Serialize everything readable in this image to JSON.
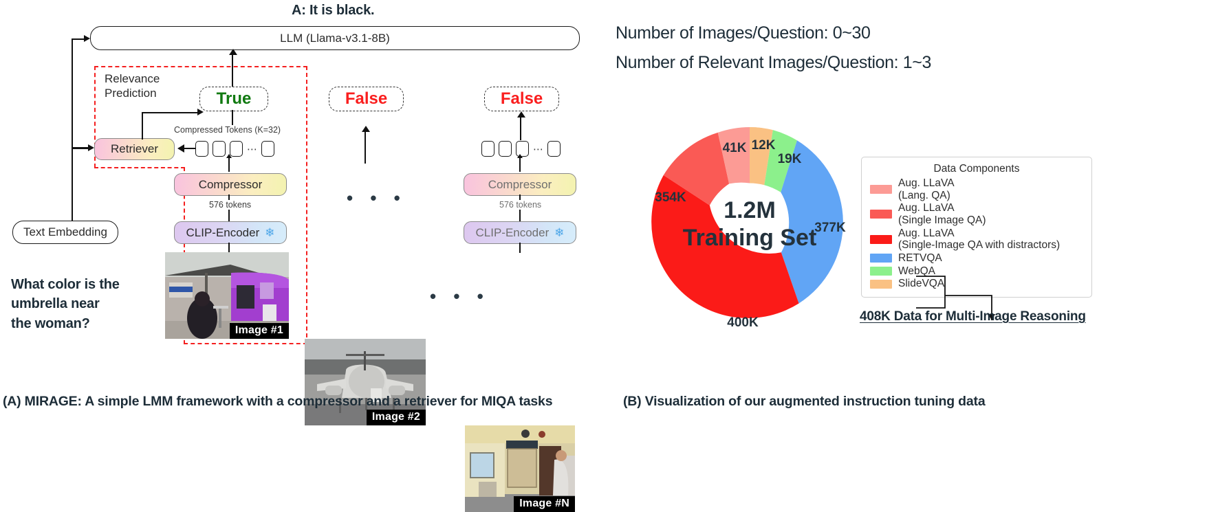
{
  "figure": {
    "panel_a_caption": "(A) MIRAGE: A simple LMM framework with a compressor and a retriever for MIQA tasks",
    "panel_b_caption": "(B) Visualization of our augmented instruction tuning data"
  },
  "panel_a": {
    "answer": "A: It is black.",
    "llm_box": "LLM (Llama-v3.1-8B)",
    "relevance_prediction": "Relevance\nPrediction",
    "relevance_prediction_line1": "Relevance",
    "relevance_prediction_line2": "Prediction",
    "retriever": "Retriever",
    "text_embedding": "Text Embedding",
    "question": "What color is the\numbrella near\nthe woman?",
    "question_line1": "What color is the",
    "question_line2": "umbrella near",
    "question_line3": "the woman?",
    "compressed_tokens_label": "Compressed Tokens (K=32)",
    "token_ellipsis": "⋯",
    "columns": [
      {
        "relevance": "True",
        "relevance_color": "#117a11",
        "compressor": "Compressor",
        "tokens_label": "576 tokens",
        "encoder": "CLIP-Encoder",
        "frozen_icon": "snowflake-icon",
        "image_tag": "Image #1"
      },
      {
        "relevance": "False",
        "relevance_color": "#fa1e1e",
        "image_tag": "Image #2"
      },
      {
        "relevance": "False",
        "relevance_color": "#fa1e1e",
        "compressor": "Compressor",
        "tokens_label": "576 tokens",
        "encoder": "CLIP-Encoder",
        "frozen_icon": "snowflake-icon",
        "image_tag": "Image #N"
      }
    ],
    "ellipsis": "• • •"
  },
  "panel_b": {
    "stat_images": "Number of Images/Question: 0~30",
    "stat_relevant": "Number of Relevant Images/Question: 1~3",
    "center_line1": "1.2M",
    "center_line2": "Training Set",
    "legend_title": "Data Components",
    "callout": "408K Data for Multi-Image Reasoning"
  },
  "chart_data": {
    "type": "pie",
    "title": "1.2M Training Set",
    "subtype": "donut",
    "labels": [
      "Aug. LLaVA (Single-Image QA with distractors)",
      "RETVQA",
      "WebQA",
      "SlideVQA",
      "Aug. LLaVA (Lang. QA)",
      "Aug. LLaVA (Single Image QA)"
    ],
    "legend_labels": [
      "Aug. LLaVA\n(Lang. QA)",
      "Aug. LLaVA\n(Single Image QA)",
      "Aug. LLaVA\n(Single-Image QA with distractors)",
      "RETVQA",
      "WebQA",
      "SlideVQA"
    ],
    "legend_rows": [
      {
        "label_line1": "Aug. LLaVA",
        "label_line2": "(Lang. QA)",
        "color": "#fc9b95"
      },
      {
        "label_line1": "Aug. LLaVA",
        "label_line2": "(Single Image QA)",
        "color": "#fa5a55"
      },
      {
        "label_line1": "Aug. LLaVA",
        "label_line2": "(Single-Image QA with distractors)",
        "color": "#fb1b18"
      },
      {
        "label_line1": "RETVQA",
        "label_line2": "",
        "color": "#61a5f5"
      },
      {
        "label_line1": "WebQA",
        "label_line2": "",
        "color": "#8cf08c"
      },
      {
        "label_line1": "SlideVQA",
        "label_line2": "",
        "color": "#fac183"
      }
    ],
    "slices": [
      {
        "name": "SlideVQA",
        "value": 12,
        "display": "12K",
        "color": "#fac183"
      },
      {
        "name": "WebQA",
        "value": 19,
        "display": "19K",
        "color": "#8cf08c"
      },
      {
        "name": "RETVQA",
        "value": 377,
        "display": "377K",
        "color": "#61a5f5"
      },
      {
        "name": "Aug. LLaVA (Single-Image QA with distractors)",
        "value": 400,
        "display": "400K",
        "color": "#fb1b18"
      },
      {
        "name": "Aug. LLaVA (Single Image QA)",
        "value": 354,
        "display": "354K",
        "color": "#fa5a55"
      },
      {
        "name": "Aug. LLaVA (Lang. QA)",
        "value": 41,
        "display": "41K",
        "color": "#fc9b95"
      }
    ],
    "total": 1203,
    "total_display": "1.2M",
    "unit": "K samples",
    "legend_position": "right",
    "annotations": [
      "408K Data for Multi-Image Reasoning"
    ]
  }
}
